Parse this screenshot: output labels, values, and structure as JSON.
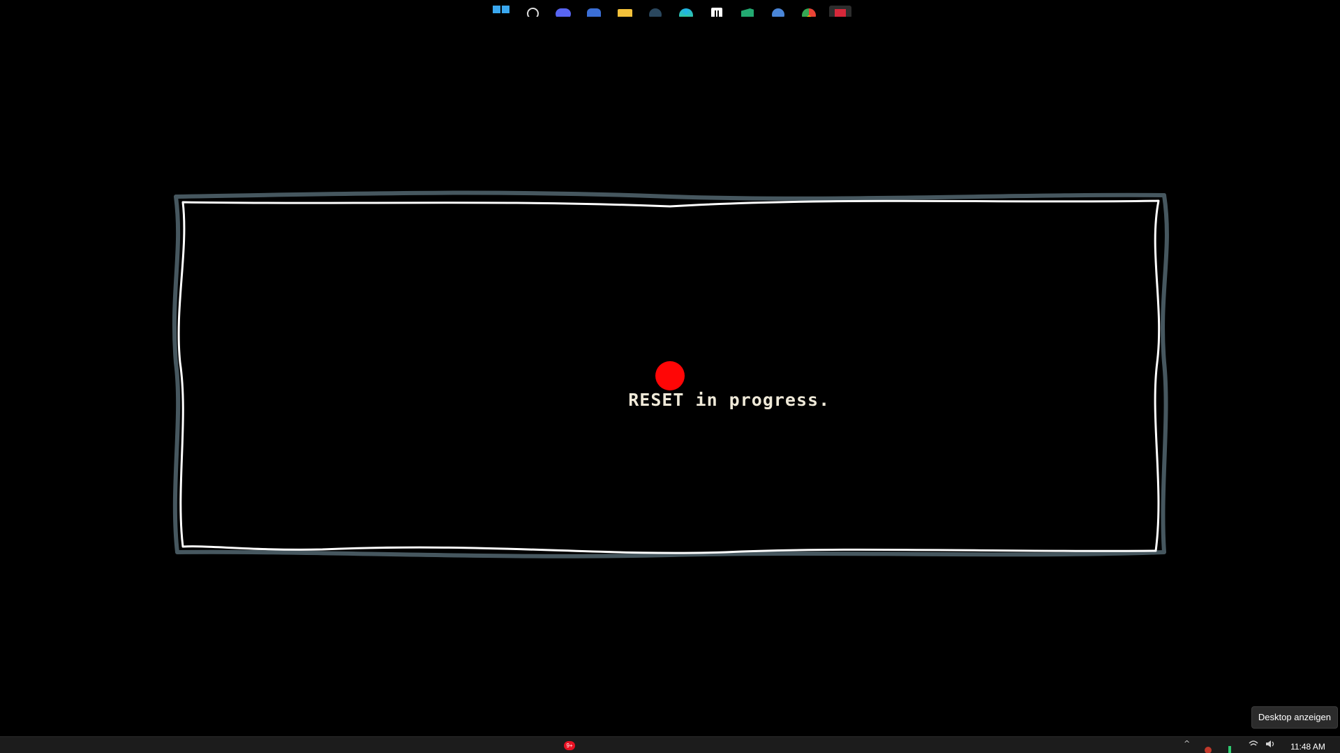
{
  "screen": {
    "background": "#000000"
  },
  "frame": {
    "outer_color": "#46575f",
    "inner_color": "#ffffff"
  },
  "message": {
    "text": "RESET in progress.",
    "color": "#efe9d8",
    "cursor_color": "#ff0606"
  },
  "tooltip": {
    "text": "Desktop anzeigen"
  },
  "taskbar": {
    "icons": [
      "windows-start-icon",
      "search-icon",
      "discord-icon",
      "app-icon",
      "file-explorer-icon",
      "steam-icon",
      "edge-icon",
      "notion-icon",
      "vscode-icon",
      "settings-icon",
      "chrome-icon",
      "active-app-icon"
    ],
    "discord_badge": "9+",
    "tray": {
      "chevron": "^",
      "network_icon": "wifi-icon",
      "volume_icon": "speaker-icon"
    },
    "clock": "11:48 AM"
  }
}
